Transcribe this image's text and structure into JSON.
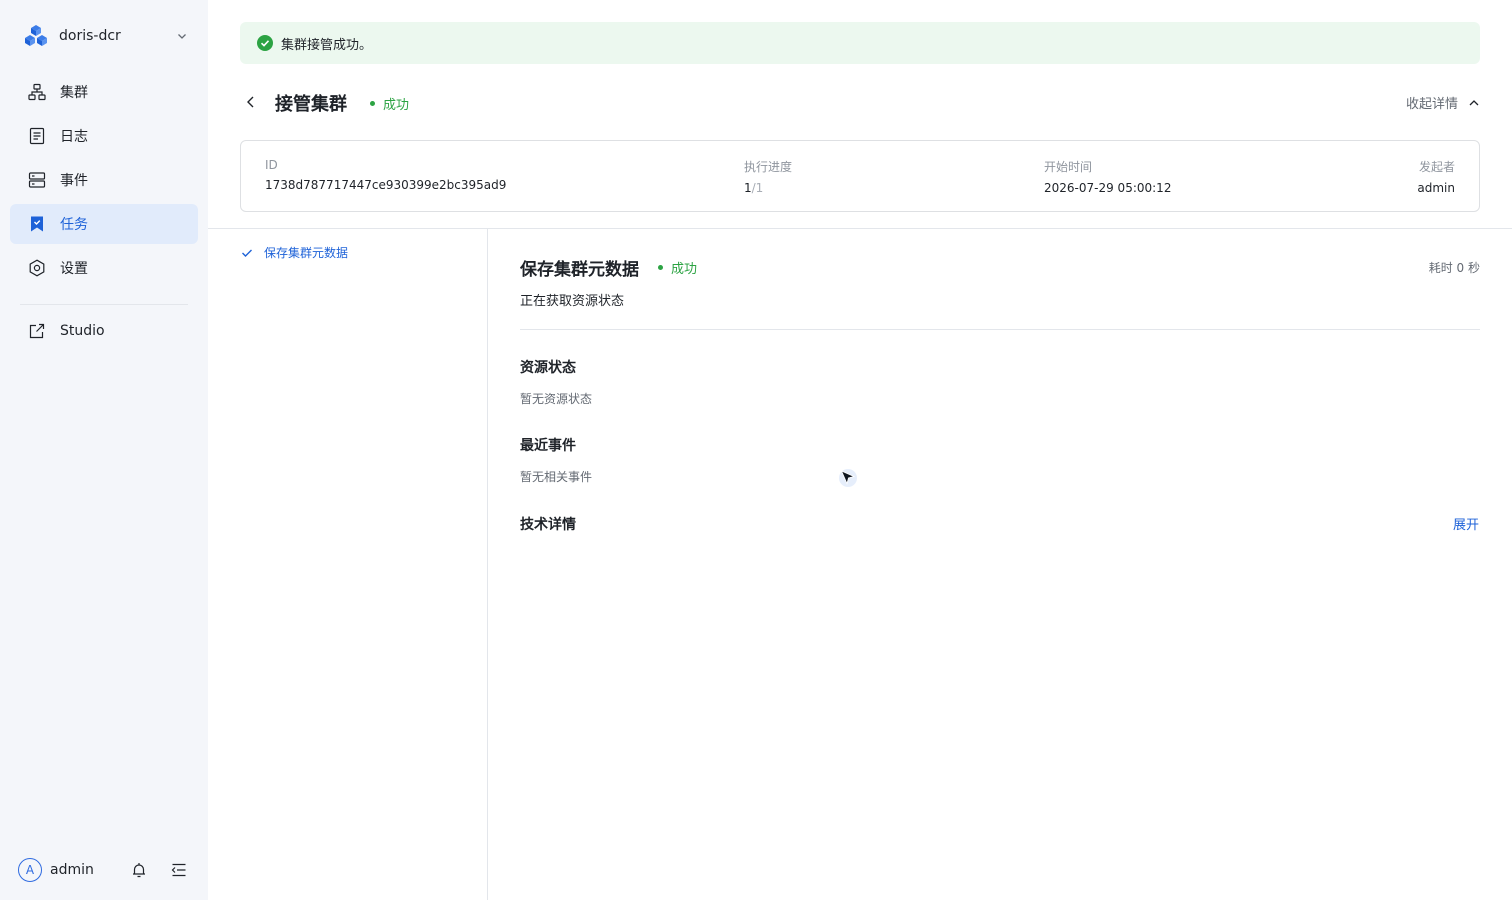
{
  "sidebar": {
    "brand": {
      "name": "doris-dcr",
      "logo_icon": "cubes-logo-icon"
    },
    "items": [
      {
        "label": "集群",
        "icon": "cluster-icon",
        "active": false
      },
      {
        "label": "日志",
        "icon": "log-icon",
        "active": false
      },
      {
        "label": "事件",
        "icon": "event-icon",
        "active": false
      },
      {
        "label": "任务",
        "icon": "bookmark-icon",
        "active": true
      },
      {
        "label": "设置",
        "icon": "gear-icon",
        "active": false
      },
      {
        "label": "Studio",
        "icon": "external-link-icon",
        "active": false
      }
    ],
    "user": {
      "avatar_letter": "A",
      "name": "admin"
    }
  },
  "toast": {
    "message": "集群接管成功。"
  },
  "header": {
    "title": "接管集群",
    "status": "成功",
    "collapse_label": "收起详情"
  },
  "info": {
    "id_label": "ID",
    "id_value": "1738d787717447ce930399e2bc395ad9",
    "progress_label": "执行进度",
    "progress_done": "1",
    "progress_total": "/1",
    "start_label": "开始时间",
    "start_value": "2026-07-29 05:00:12",
    "initiator_label": "发起者",
    "initiator_value": "admin"
  },
  "steps": [
    {
      "label": "保存集群元数据"
    }
  ],
  "detail": {
    "title": "保存集群元数据",
    "status": "成功",
    "duration": "耗时 0 秒",
    "subtitle": "正在获取资源状态",
    "resource_heading": "资源状态",
    "resource_empty": "暂无资源状态",
    "events_heading": "最近事件",
    "events_empty": "暂无相关事件",
    "tech_heading": "技术详情",
    "expand_label": "展开"
  },
  "colors": {
    "accent": "#1e62d8",
    "success": "#2ca343",
    "sidebar_bg": "#f4f6fa",
    "active_bg": "#e1ebfb",
    "toast_bg": "#ecf8ef"
  }
}
